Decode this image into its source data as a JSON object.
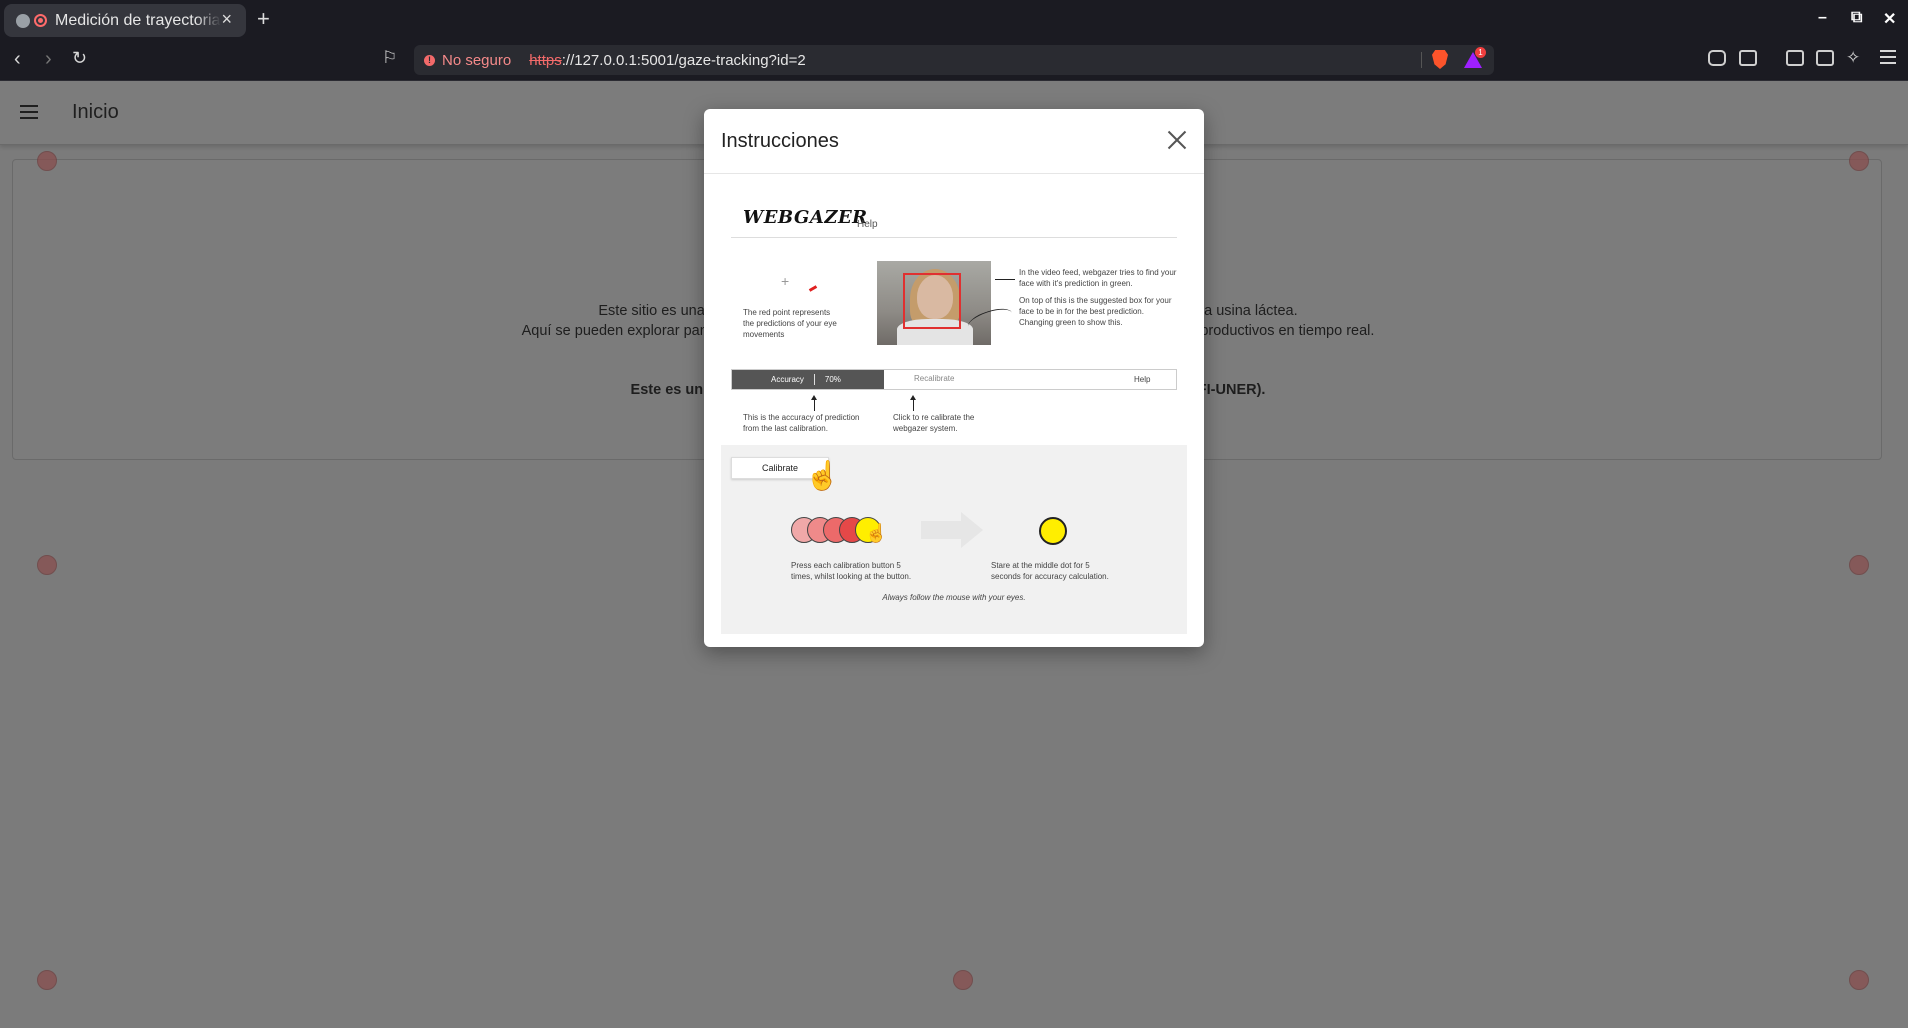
{
  "browser": {
    "tab_title": "Medición de trayectoria",
    "tab_close": "×",
    "new_tab": "+",
    "url_security": "No seguro",
    "url_protocol": "https",
    "url_rest": "://127.0.0.1:5001/gaze-tracking?id=2",
    "notification_count": "1"
  },
  "app": {
    "title": "Inicio",
    "intro_line1": "Este sitio es una c",
    "intro_line1_end": "na usina láctea.",
    "intro_line2": "Aquí se pueden explorar paneles i",
    "intro_line2_end": "esos productivos en tiempo real.",
    "dev_line_start": "Este es un desarrol",
    "dev_line_end": "(LICA-FI-UNER)."
  },
  "modal": {
    "title": "Instrucciones"
  },
  "help_image": {
    "logo": "WEBGAZER",
    "logo_suffix": "Help",
    "red_point_text": "The red point represents the predictions of your eye movements",
    "video_text": "In the video feed, webgazer tries to find your face with it's prediction in green.",
    "box_text": "On top of this is the suggested box for your face to be in for the best prediction. Changing green to show this.",
    "accuracy_label": "Accuracy",
    "accuracy_value": "70%",
    "recalibrate_label": "Recalibrate",
    "help_label": "Help",
    "accuracy_text": "This is the accuracy of prediction from the last calibration.",
    "recalibrate_text": "Click to re calibrate the webgazer system.",
    "calibrate_button": "Calibrate",
    "press_text": "Press each calibration button 5 times, whilst looking at the button.",
    "stare_text": "Stare at the middle dot for 5 seconds for accuracy calculation.",
    "follow_text": "Always follow the mouse with your eyes."
  },
  "colors": {
    "accent_red": "#f36a6a",
    "calibration_yellow": "#ffee00",
    "overlay_gray": "#7b7b7b"
  }
}
